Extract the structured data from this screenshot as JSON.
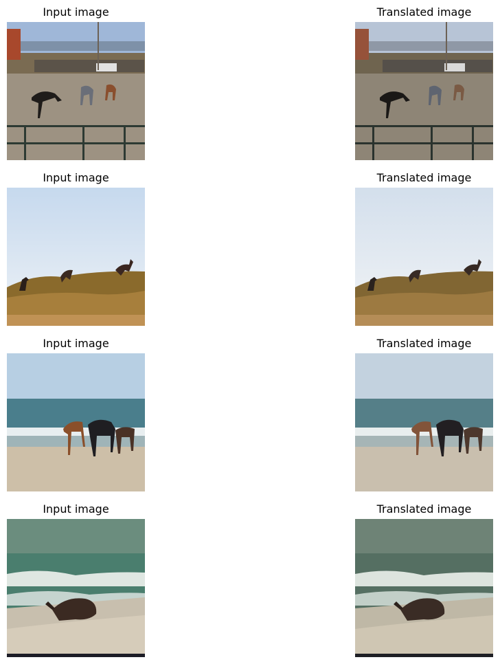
{
  "figure": {
    "rows": [
      {
        "input_title": "Input image",
        "output_title": "Translated image",
        "scene": "rodeo-arena-horses"
      },
      {
        "input_title": "Input image",
        "output_title": "Translated image",
        "scene": "horses-on-grassy-hill"
      },
      {
        "input_title": "Input image",
        "output_title": "Translated image",
        "scene": "horses-on-beach"
      },
      {
        "input_title": "Input image",
        "output_title": "Translated image",
        "scene": "horse-rolling-in-sand"
      }
    ]
  },
  "colors": {
    "sky_blue": "#8fb0d8",
    "sky_white": "#e8eef6",
    "sand": "#b9ac97",
    "grass_brown": "#8a6a2c",
    "sea": "#4a7e86"
  }
}
